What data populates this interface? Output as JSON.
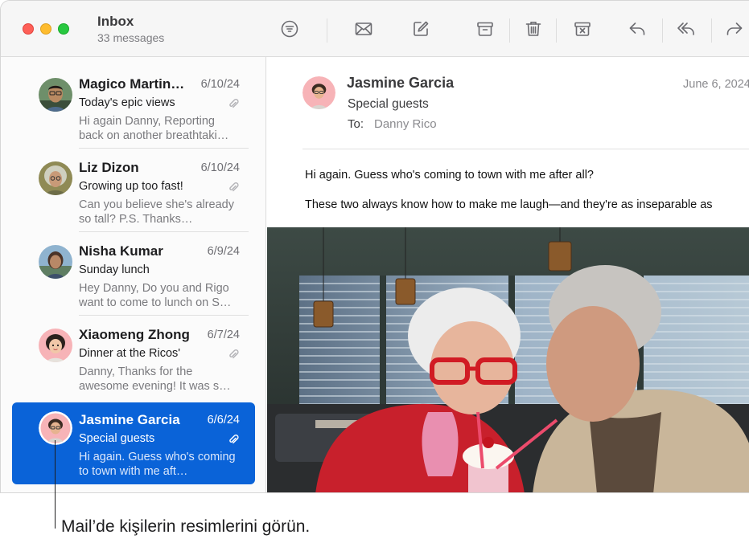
{
  "toolbar": {
    "mailbox_title": "Inbox",
    "message_count": "33 messages",
    "icons": [
      "filter-icon",
      "envelope-icon",
      "compose-icon",
      "archive-icon",
      "trash-icon",
      "junk-icon",
      "reply-icon",
      "reply-all-icon",
      "forward-icon"
    ]
  },
  "messages": [
    {
      "sender": "Magico Martin…",
      "date": "6/10/24",
      "subject": "Today's epic views",
      "preview": "Hi again Danny, Reporting back on another breathtaki…",
      "attachment": true
    },
    {
      "sender": "Liz Dizon",
      "date": "6/10/24",
      "subject": "Growing up too fast!",
      "preview": "Can you believe she's already so tall? P.S. Thanks…",
      "attachment": true
    },
    {
      "sender": "Nisha Kumar",
      "date": "6/9/24",
      "subject": "Sunday lunch",
      "preview": "Hey Danny, Do you and Rigo want to come to lunch on S…",
      "attachment": false
    },
    {
      "sender": "Xiaomeng Zhong",
      "date": "6/7/24",
      "subject": "Dinner at the Ricos'",
      "preview": "Danny, Thanks for the awesome evening! It was s…",
      "attachment": true
    },
    {
      "sender": "Jasmine Garcia",
      "date": "6/6/24",
      "subject": "Special guests",
      "preview": "Hi again. Guess who's coming to town with me aft…",
      "attachment": true,
      "selected": true
    }
  ],
  "reader": {
    "from": "Jasmine Garcia",
    "date": "June 6, 2024",
    "subject": "Special guests",
    "to_label": "To:",
    "to": "Danny Rico",
    "body_line1": "Hi again. Guess who's coming to town with me after all?",
    "body_line2": "These two always know how to make me laugh—and they're as inseparable as"
  },
  "callout": {
    "text": "Mail’de kişilerin resimlerini görün."
  },
  "colors": {
    "selection": "#0a63d8",
    "close": "#fe5f57",
    "minimize": "#febc2e",
    "zoom": "#28c840"
  }
}
